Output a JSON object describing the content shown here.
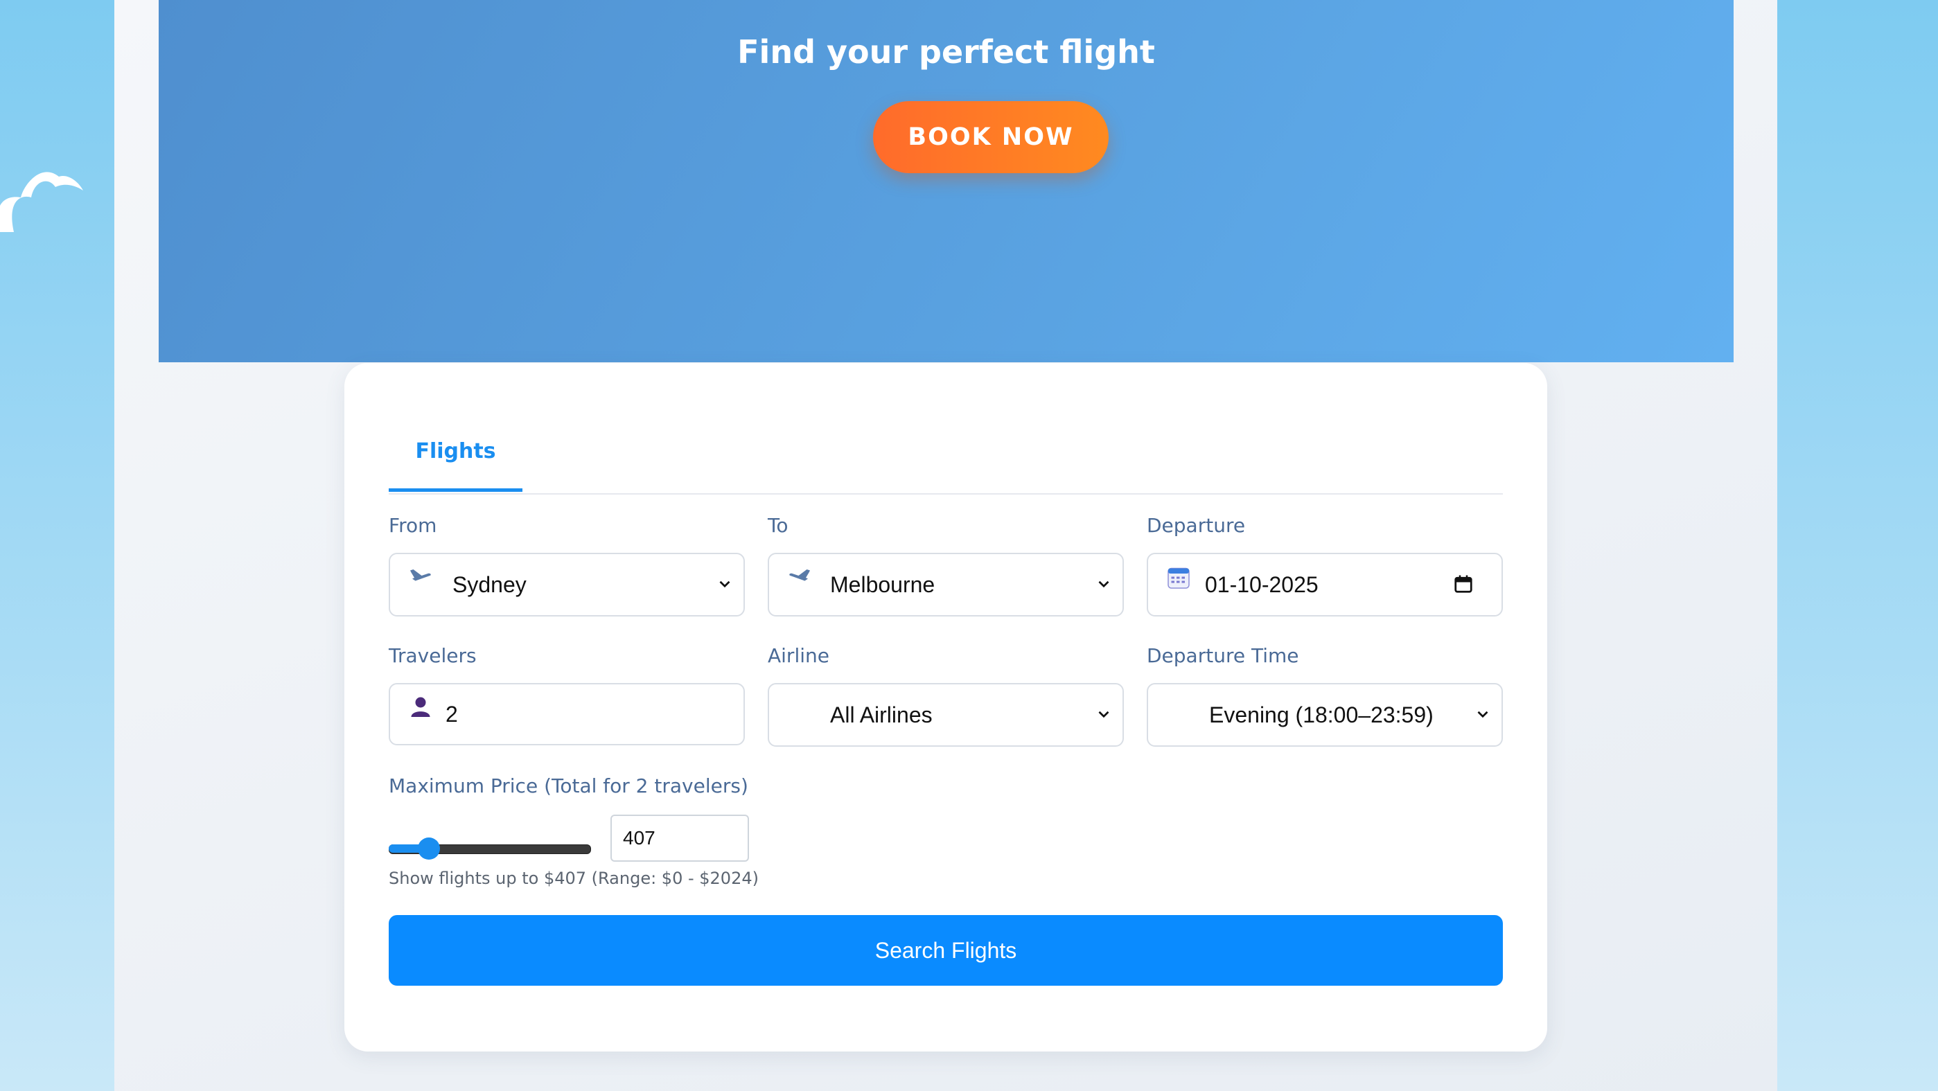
{
  "hero": {
    "title": "Find your perfect flight",
    "book_label": "BOOK NOW"
  },
  "tabs": [
    {
      "label": "Flights",
      "active": true
    }
  ],
  "form": {
    "from": {
      "label": "From",
      "value": "Sydney",
      "icon": "plane-departure-icon"
    },
    "to": {
      "label": "To",
      "value": "Melbourne",
      "icon": "plane-arrival-icon"
    },
    "departure": {
      "label": "Departure",
      "value": "01-10-2025",
      "icon": "calendar-icon"
    },
    "travelers": {
      "label": "Travelers",
      "value": "2",
      "icon": "person-icon"
    },
    "airline": {
      "label": "Airline",
      "value": "All Airlines"
    },
    "departure_time": {
      "label": "Departure Time",
      "value": "Evening (18:00–23:59)"
    },
    "max_price": {
      "label": "Maximum Price (Total for 2 travelers)",
      "value": "407",
      "min": 0,
      "max": 2024,
      "hint": "Show flights up to $407 (Range: $0 - $2024)"
    },
    "search_label": "Search Flights"
  },
  "colors": {
    "accent": "#0a8bff",
    "book_button": "#ff7a25",
    "hero": "#569cdc",
    "label": "#4a6a96"
  }
}
